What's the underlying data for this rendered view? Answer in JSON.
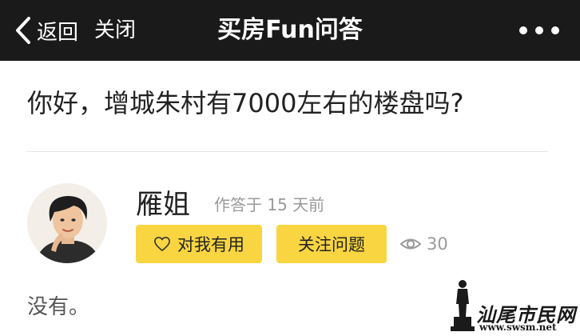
{
  "nav": {
    "back_label": "返回",
    "close_label": "关闭",
    "title": "买房Fun问答"
  },
  "question": {
    "text": "你好，增城朱村有7000左右的楼盘吗?"
  },
  "answer": {
    "author": "雁姐",
    "time": "作答于 15 天前",
    "useful_label": "对我有用",
    "follow_label": "关注问题",
    "views": "30",
    "content": "没有。"
  },
  "watermark": {
    "text": "汕尾市民网",
    "url": "www.swsm.net"
  },
  "colors": {
    "nav_bg": "#1a1a1a",
    "button_yellow": "#f8d541",
    "muted_gray": "#9a9a9a"
  },
  "icons": {
    "back": "chevron-left-icon",
    "more": "more-dots-icon",
    "heart": "heart-outline-icon",
    "views": "eye-icon"
  }
}
